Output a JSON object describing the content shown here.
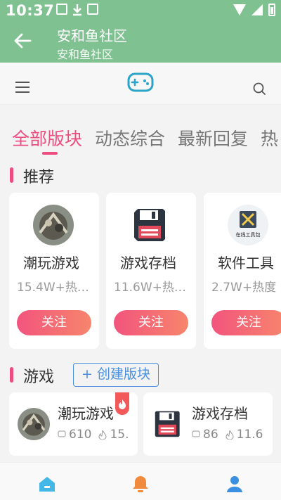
{
  "status": {
    "time": "10:37"
  },
  "header": {
    "title": "安和鱼社区",
    "subtitle": "安和鱼社区"
  },
  "tabs": [
    {
      "label": "全部版块",
      "active": true
    },
    {
      "label": "动态综合",
      "active": false
    },
    {
      "label": "最新回复",
      "active": false
    },
    {
      "label": "热",
      "active": false
    }
  ],
  "recommend": {
    "title": "推荐",
    "follow_label": "关注",
    "cards": [
      {
        "name": "潮玩游戏",
        "stats": "15.4W+热…",
        "icon": "game-avatar"
      },
      {
        "name": "游戏存档",
        "stats": "11.6W+热…",
        "icon": "floppy-disk-icon"
      },
      {
        "name": "软件工具",
        "stats": "2.7W+热度",
        "icon": "tools-icon",
        "icon_text": "在线工具包"
      }
    ]
  },
  "games": {
    "title": "游戏",
    "create_label": "+ 创建版块",
    "cards": [
      {
        "name": "潮玩游戏",
        "posts": "610",
        "heat": "15.",
        "icon": "game-avatar"
      },
      {
        "name": "游戏存档",
        "posts": "86",
        "heat": "11.6",
        "icon": "floppy-disk-icon"
      }
    ]
  },
  "colors": {
    "header": "#7fc190",
    "accent": "#ee4d80",
    "link": "#4a8fde"
  }
}
